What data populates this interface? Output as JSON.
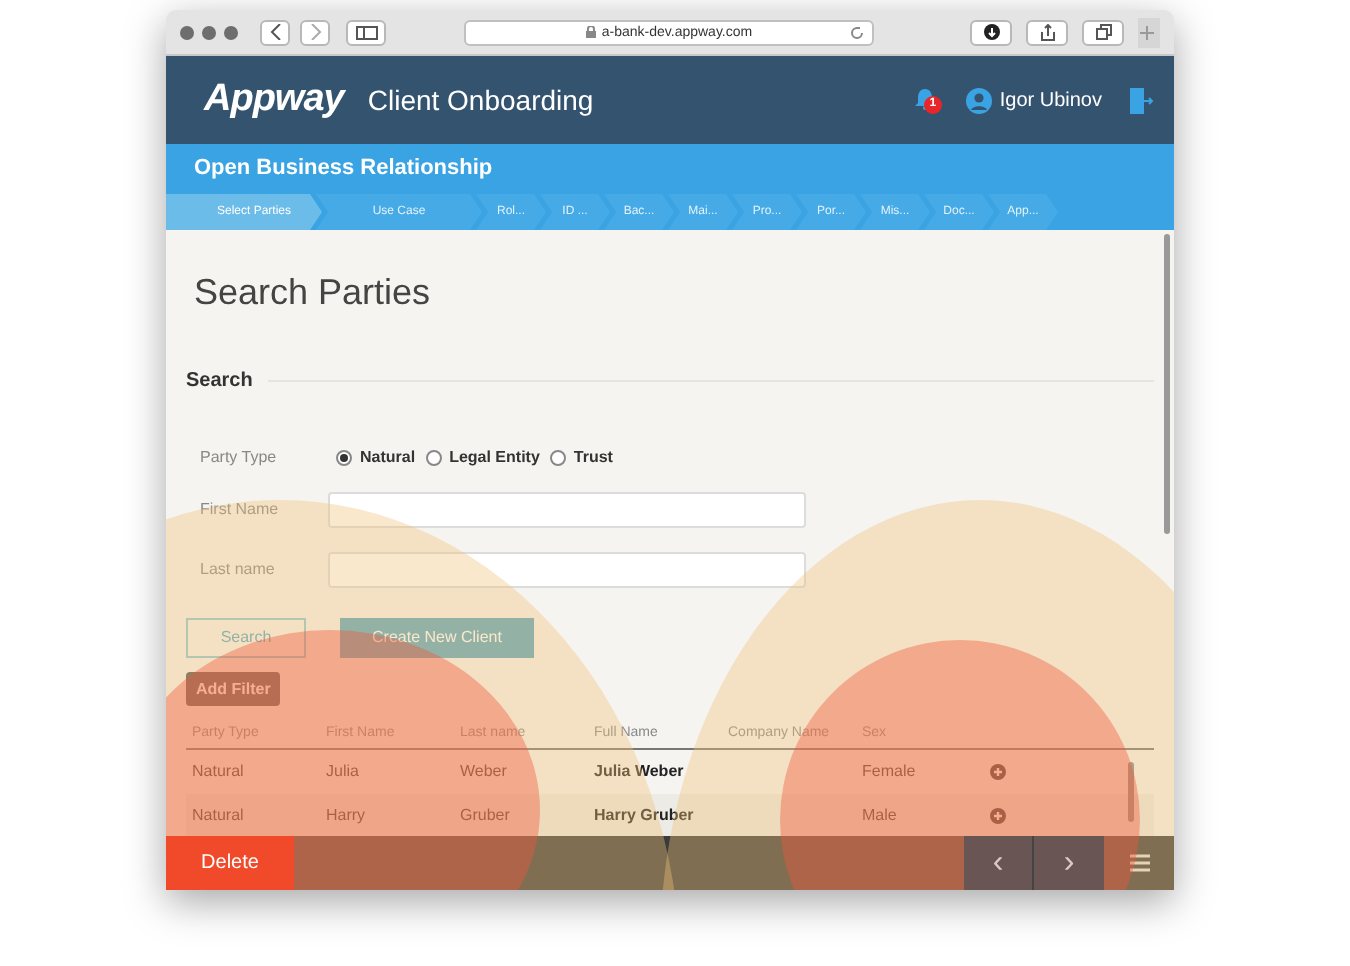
{
  "browser": {
    "url": "a-bank-dev.appway.com"
  },
  "header": {
    "logo": "Appway",
    "app_title": "Client Onboarding",
    "notification_count": "1",
    "user": "Igor Ubinov"
  },
  "process": {
    "title": "Open Business Relationship",
    "steps": [
      {
        "label": "Select Parties",
        "selected": true
      },
      {
        "label": "Use Case",
        "selected": false
      },
      {
        "label": "Rol...",
        "selected": false
      },
      {
        "label": "ID ...",
        "selected": false
      },
      {
        "label": "Bac...",
        "selected": false
      },
      {
        "label": "Mai...",
        "selected": false
      },
      {
        "label": "Pro...",
        "selected": false
      },
      {
        "label": "Por...",
        "selected": false
      },
      {
        "label": "Mis...",
        "selected": false
      },
      {
        "label": "Doc...",
        "selected": false
      },
      {
        "label": "App...",
        "selected": false
      }
    ]
  },
  "page_title": "Search Parties",
  "section_title": "Search",
  "party_type": {
    "label": "Party Type",
    "options": [
      {
        "label": "Natural",
        "selected": true
      },
      {
        "label": "Legal Entity",
        "selected": false
      },
      {
        "label": "Trust",
        "selected": false
      }
    ]
  },
  "fields": [
    {
      "label": "First Name"
    },
    {
      "label": "Last name"
    }
  ],
  "buttons": {
    "search": "Search",
    "create": "Create New Client",
    "add_filter": "Add Filter"
  },
  "table": {
    "columns": [
      "Party Type",
      "First Name",
      "Last name",
      "Full Name",
      "Company Name",
      "Sex"
    ],
    "rows": [
      [
        "Natural",
        "Julia",
        "Weber",
        "Julia Weber",
        "",
        "Female"
      ],
      [
        "Natural",
        "Harry",
        "Gruber",
        "Harry Gruber",
        "",
        "Male"
      ]
    ]
  },
  "footer": {
    "delete": "Delete",
    "prev": "‹",
    "next": "›"
  }
}
